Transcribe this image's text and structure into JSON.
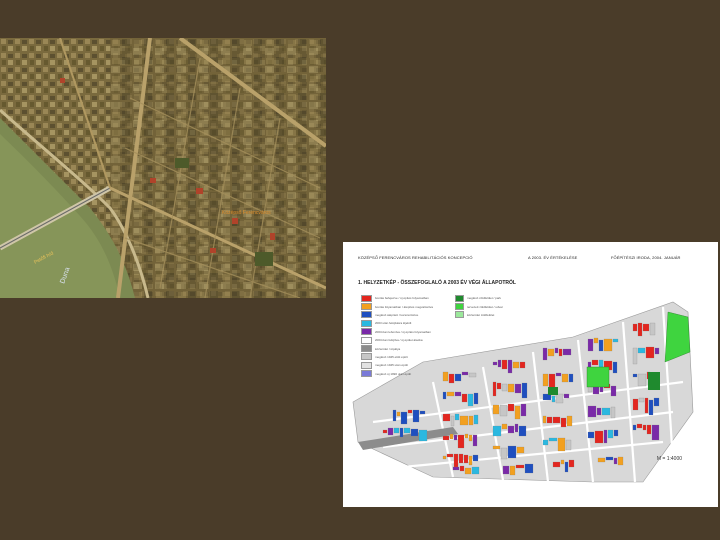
{
  "page": {
    "background": "#4a3c29"
  },
  "aerial_photo": {
    "labels": {
      "bridge": "Petőfi híd",
      "river": "Duna",
      "district": "Középső Ferencváros"
    }
  },
  "plan_map": {
    "header": {
      "project": "KÖZÉPSŐ FERENCVÁROS REHABILITÁCIÓS KONCEPCIÓ",
      "evaluation": "A 2003. ÉV ÉRTÉKELÉSE",
      "office": "FŐÉPÍTÉSZI IRODA, 2004. JANUÁR"
    },
    "subtitle": "1. HELYZETKÉP - ÖSSZEFOGLALÓ A 2003 ÉV VÉGI ÁLLAPOTRÓL",
    "scale": "M = 1:4000",
    "legend_left": [
      {
        "color": "#e3261f",
        "label": "bontás befejezve / új építés folyamatban"
      },
      {
        "color": "#f2a020",
        "label": "bontás folyamatban / átépítés megvalósítva"
      },
      {
        "color": "#1f4fbf",
        "label": "meglévő átépített / korszerűsítve"
      },
      {
        "color": "#2bb8e0",
        "label": "2003 után felújításra kijelölt"
      },
      {
        "color": "#7a2aa8",
        "label": "2003-ban lebontva / új építés folyamatban"
      },
      {
        "color": "#ffffff",
        "label": "2003-ban felújítva / új épület átadva"
      },
      {
        "color": "#8c8c8c",
        "label": "közterület / útpálya"
      },
      {
        "color": "#c6c6c6",
        "label": "meglévő 1945 előtt épült"
      },
      {
        "color": "#e2e2e2",
        "label": "meglévő 1945 után épült"
      },
      {
        "color": "#7a7ad8",
        "label": "meglévő új 1990 után épült"
      }
    ],
    "legend_right": [
      {
        "color": "#1f8a2e",
        "label": "meglévő zöldfelület / park"
      },
      {
        "color": "#3fd43f",
        "label": "tervezett zöldfelület / udvar"
      },
      {
        "color": "#9be89b",
        "label": "közterület zöldfelület"
      }
    ],
    "colors": {
      "red": "#e3261f",
      "orange": "#f2a020",
      "blue": "#1f4fbf",
      "cyan": "#2bb8e0",
      "purple": "#7a2aa8",
      "green": "#1f8a2e",
      "lightgreen": "#3fd43f",
      "gray": "#8c8c8c",
      "lightgray": "#c6c6c6"
    }
  }
}
